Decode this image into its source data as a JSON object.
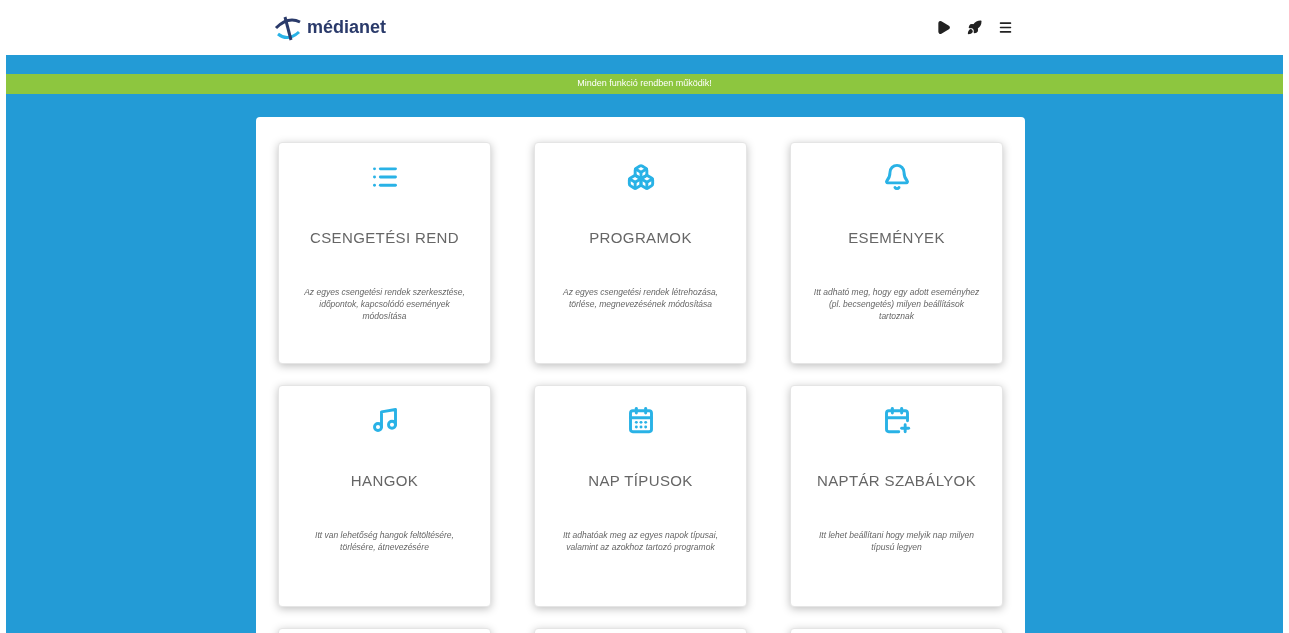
{
  "header": {
    "logo_text": "médianet",
    "actions": [
      {
        "kind": "play"
      },
      {
        "kind": "rocket"
      },
      {
        "kind": "menu"
      }
    ]
  },
  "status_banner": {
    "text": "Minden funkció rendben működik!"
  },
  "cards": [
    {
      "title": "CSENGETÉSI REND",
      "description": "Az egyes csengetési rendek szerkesztése, időpontok, kapcsolódó események módosítása"
    },
    {
      "title": "PROGRAMOK",
      "description": "Az egyes csengetési rendek létrehozása, törlése, megnevezésének módosítása"
    },
    {
      "title": "ESEMÉNYEK",
      "description": "Itt adható meg, hogy egy adott eseményhez (pl. becsengetés) milyen beállítások tartoznak"
    },
    {
      "title": "HANGOK",
      "description": "Itt van lehetőség hangok feltöltésére, törlésére, átnevezésére"
    },
    {
      "title": "NAP TÍPUSOK",
      "description": "Itt adhatóak meg az egyes napok típusai, valamint az azokhoz tartozó programok"
    },
    {
      "title": "NAPTÁR SZABÁLYOK",
      "description": "Itt lehet beállítani hogy melyik nap milyen típusú legyen"
    }
  ]
}
